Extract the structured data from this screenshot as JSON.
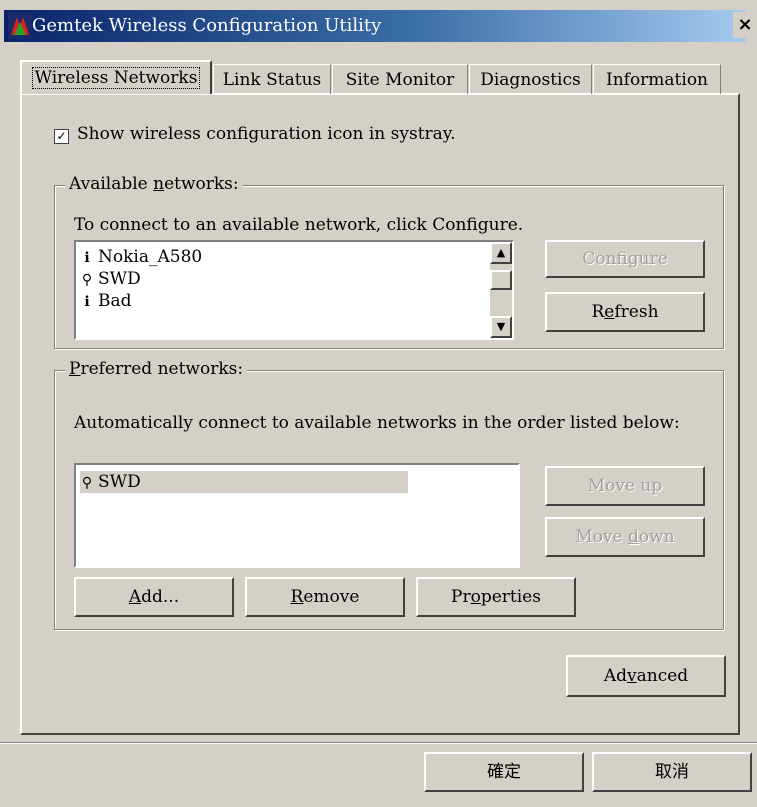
{
  "window": {
    "title": "Gemtek Wireless Configuration Utility",
    "close_label": "×"
  },
  "tabs": [
    {
      "label": "Wireless Networks",
      "active": true
    },
    {
      "label": "Link Status",
      "active": false
    },
    {
      "label": "Site Monitor",
      "active": false
    },
    {
      "label": "Diagnostics",
      "active": false
    },
    {
      "label": "Information",
      "active": false
    }
  ],
  "systray": {
    "checked": true,
    "check_glyph": "✓",
    "label": "Show wireless configuration icon in systray."
  },
  "available": {
    "group_label_pre": "Available ",
    "group_label_ul": "n",
    "group_label_post": "etworks:",
    "description": "To connect to an available network, click Configure.",
    "items": [
      {
        "name": "Nokia_A580",
        "icon": "info-icon",
        "glyph": "ℹ"
      },
      {
        "name": "SWD",
        "icon": "antenna-icon",
        "glyph": "⚲"
      },
      {
        "name": "Bad",
        "icon": "info-icon",
        "glyph": "ℹ"
      }
    ],
    "configure_label": "Configure",
    "refresh_pre": "R",
    "refresh_ul": "e",
    "refresh_post": "fresh",
    "scroll_up_glyph": "▲",
    "scroll_down_glyph": "▼"
  },
  "preferred": {
    "group_label_ul": "P",
    "group_label_post": "referred networks:",
    "description": "Automatically connect to available networks in the order listed below:",
    "items": [
      {
        "name": "SWD",
        "icon": "antenna-icon",
        "glyph": "⚲"
      }
    ],
    "move_up_label": "Move up",
    "move_down_pre": "Move ",
    "move_down_ul": "d",
    "move_down_post": "own",
    "add_ul": "A",
    "add_post": "dd...",
    "remove_ul": "R",
    "remove_post": "emove",
    "properties_pre": "Pr",
    "properties_ul": "o",
    "properties_post": "perties"
  },
  "advanced": {
    "pre": "Ad",
    "ul": "v",
    "post": "anced"
  },
  "footer": {
    "ok_label": "確定",
    "cancel_label": "取消"
  }
}
